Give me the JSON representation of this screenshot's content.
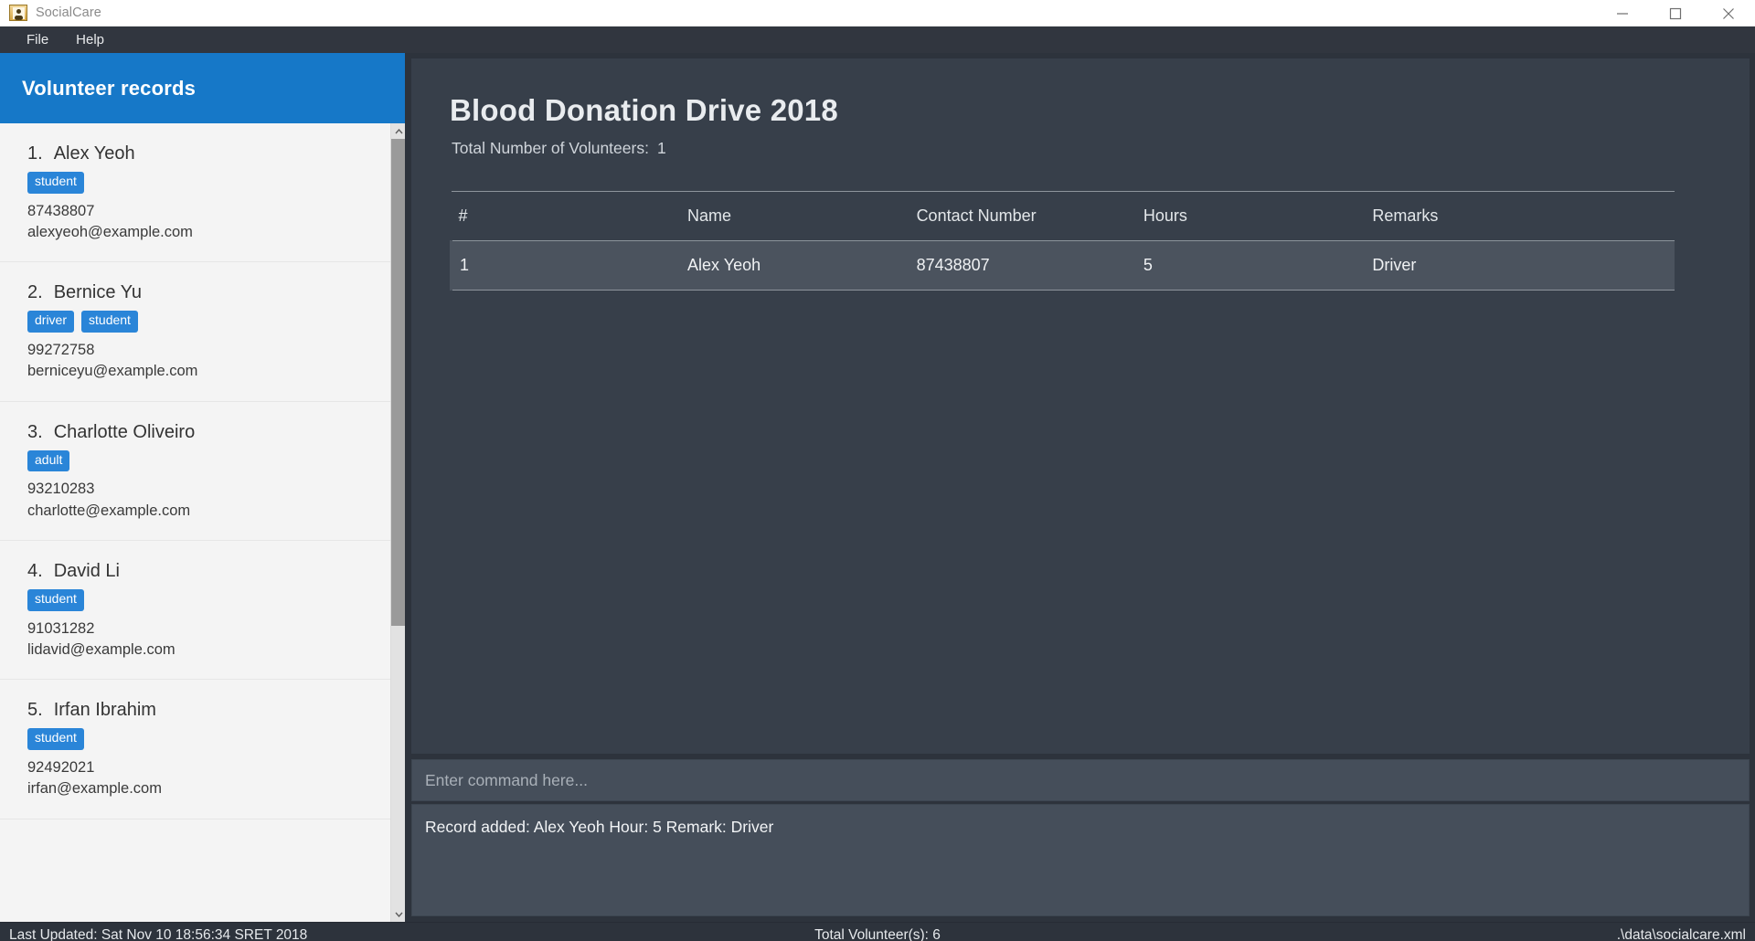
{
  "window": {
    "title": "SocialCare",
    "icon": "app-icon",
    "buttons": [
      {
        "name": "minimize",
        "glyph": "minimize-icon"
      },
      {
        "name": "maximize",
        "glyph": "maximize-icon"
      },
      {
        "name": "close",
        "glyph": "close-icon"
      }
    ]
  },
  "menubar": {
    "items": [
      {
        "label": "File"
      },
      {
        "label": "Help"
      }
    ]
  },
  "sidebar": {
    "header_title": "Volunteer records",
    "accent_color": "#1678c8",
    "people": [
      {
        "index": "1.",
        "name": "Alex Yeoh",
        "tags": [
          "student"
        ],
        "phone": "87438807",
        "email": "alexyeoh@example.com"
      },
      {
        "index": "2.",
        "name": "Bernice Yu",
        "tags": [
          "driver",
          "student"
        ],
        "phone": "99272758",
        "email": "berniceyu@example.com"
      },
      {
        "index": "3.",
        "name": "Charlotte Oliveiro",
        "tags": [
          "adult"
        ],
        "phone": "93210283",
        "email": "charlotte@example.com"
      },
      {
        "index": "4.",
        "name": "David Li",
        "tags": [
          "student"
        ],
        "phone": "91031282",
        "email": "lidavid@example.com"
      },
      {
        "index": "5.",
        "name": "Irfan Ibrahim",
        "tags": [
          "student"
        ],
        "phone": "92492021",
        "email": "irfan@example.com"
      }
    ]
  },
  "main": {
    "drive_title": "Blood Donation Drive 2018",
    "total_label": "Total Number of Volunteers:",
    "total_value": "1",
    "table": {
      "headers": [
        "#",
        "Name",
        "Contact Number",
        "Hours",
        "Remarks"
      ],
      "rows": [
        {
          "num": "1",
          "name": "Alex Yeoh",
          "contact": "87438807",
          "hours": "5",
          "remarks": "Driver"
        }
      ]
    }
  },
  "command": {
    "placeholder": "Enter command here...",
    "value": "",
    "result": "Record added: Alex Yeoh Hour: 5 Remark: Driver"
  },
  "statusbar": {
    "last_updated": "Last Updated: Sat Nov 10 18:56:34 SRET 2018",
    "total_volunteers": "Total Volunteer(s): 6",
    "file_path": ".\\data\\socialcare.xml"
  }
}
